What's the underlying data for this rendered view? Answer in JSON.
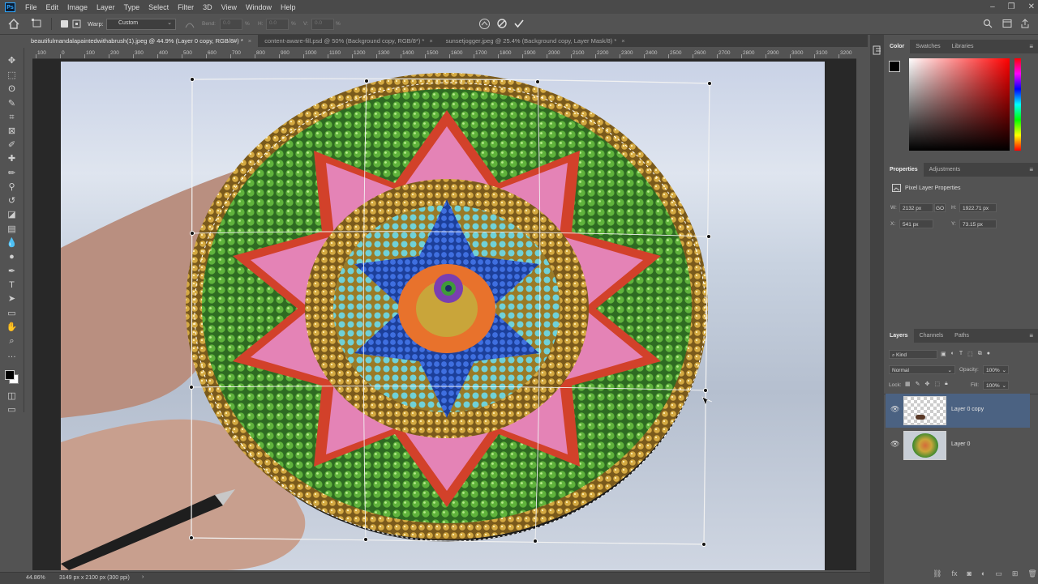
{
  "menubar": {
    "logo": "Ps",
    "items": [
      "File",
      "Edit",
      "Image",
      "Layer",
      "Type",
      "Select",
      "Filter",
      "3D",
      "View",
      "Window",
      "Help"
    ]
  },
  "options": {
    "warp_label": "Warp:",
    "warp_value": "Custom",
    "bend_label": "Bend:",
    "bend_value": "0.0",
    "h_label": "H:",
    "h_value": "0.0",
    "v_label": "V:",
    "v_value": "0.0",
    "percent": "%"
  },
  "tabs": [
    {
      "label": "beautifulmandalapaintedwithabrush(1).jpeg @ 44.9% (Layer 0 copy, RGB/8#) *",
      "close": "×"
    },
    {
      "label": "content-aware-fill.psd @ 50% (Background copy, RGB/8*) *",
      "close": "×"
    },
    {
      "label": "sunsetjogger.jpeg @ 25.4% (Background copy, Layer Mask/8) *",
      "close": "×"
    }
  ],
  "ruler_ticks": [
    "100",
    "0",
    "100",
    "200",
    "300",
    "400",
    "500",
    "600",
    "700",
    "800",
    "900",
    "1000",
    "1100",
    "1200",
    "1300",
    "1400",
    "1500",
    "1600",
    "1700",
    "1800",
    "1900",
    "2000",
    "2100",
    "2200",
    "2300",
    "2400",
    "2500",
    "2600",
    "2700",
    "2800",
    "2900",
    "3000",
    "3100",
    "3200"
  ],
  "status": {
    "zoom": "44.86%",
    "doc": "3149 px x 2100 px (300 ppi)",
    "arrow": "›"
  },
  "color_panel": {
    "tabs": [
      "Color",
      "Swatches",
      "Libraries"
    ]
  },
  "properties_panel": {
    "tabs": [
      "Properties",
      "Adjustments"
    ],
    "title": "Pixel Layer Properties",
    "w_label": "W:",
    "w_value": "2132 px",
    "link_label": "GO",
    "h_label": "H:",
    "h_value": "1922.71 px",
    "x_label": "X:",
    "x_value": "541 px",
    "y_label": "Y:",
    "y_value": "73.15 px"
  },
  "layers_panel": {
    "tabs": [
      "Layers",
      "Channels",
      "Paths"
    ],
    "kind_label": "Kind",
    "blend_mode": "Normal",
    "opacity_label": "Opacity:",
    "opacity_value": "100%",
    "lock_label": "Lock:",
    "fill_label": "Fill:",
    "fill_value": "100%",
    "layers": [
      {
        "name": "Layer 0 copy",
        "selected": true
      },
      {
        "name": "Layer 0",
        "selected": false
      }
    ]
  },
  "colors": {
    "accent": "#31a8ff",
    "selected_layer": "#4b6282",
    "foreground": "#000000",
    "background": "#ffffff"
  },
  "icons": [
    "move-icon",
    "marquee-icon",
    "lasso-icon",
    "quick-select-icon",
    "crop-icon",
    "frame-icon",
    "eyedropper-icon",
    "healing-icon",
    "brush-icon",
    "stamp-icon",
    "history-brush-icon",
    "eraser-icon",
    "gradient-icon",
    "blur-icon",
    "dodge-icon",
    "pen-icon",
    "type-icon",
    "path-select-icon",
    "shape-icon",
    "hand-icon",
    "zoom-icon",
    "more-icon"
  ]
}
